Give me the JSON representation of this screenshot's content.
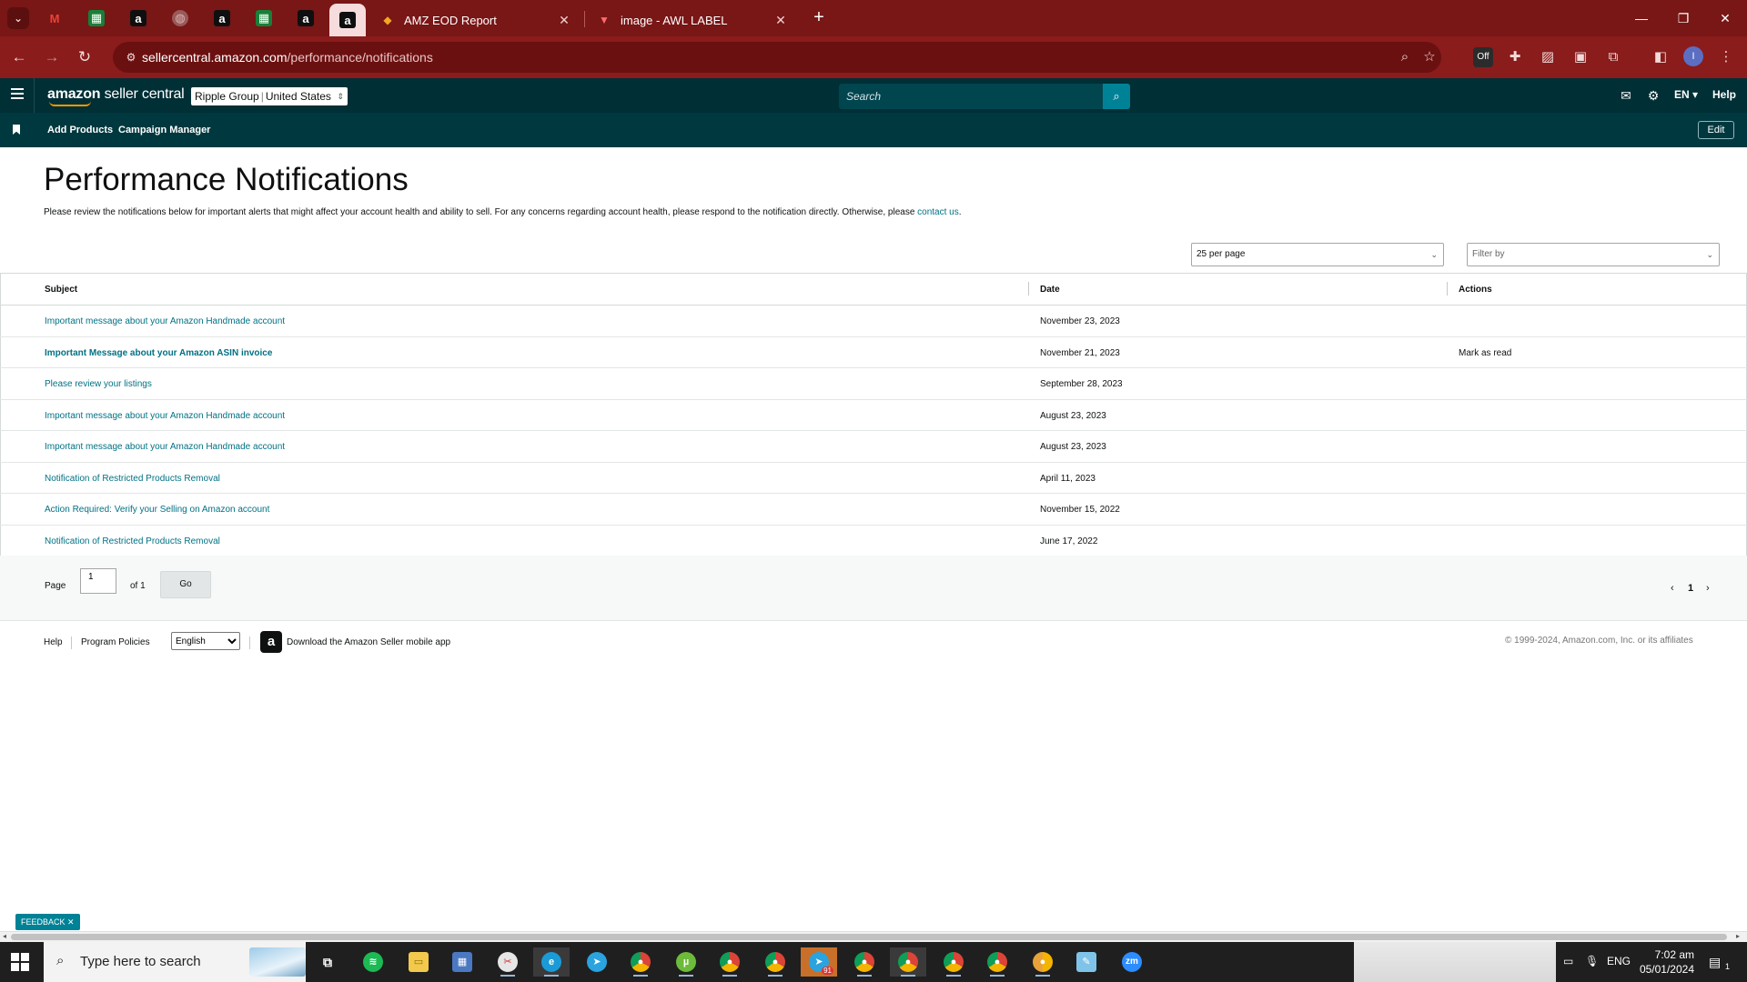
{
  "browser": {
    "tabs": [
      {
        "title": "AMZ EOD Report",
        "close": "✕"
      },
      {
        "title": "image - AWL LABEL",
        "close": "✕"
      }
    ],
    "pinned_tabs": [
      "gmail-icon",
      "sheets-icon",
      "amazon-icon",
      "globe-icon",
      "amazon-icon",
      "sheets-icon",
      "amazon-icon",
      "amazon-icon"
    ],
    "address": {
      "host": "sellercentral.amazon.com",
      "path": "/performance/notifications"
    },
    "profile_initial": "I",
    "extension_badge": "Off"
  },
  "header": {
    "logo_brand": "amazon",
    "logo_product": " seller central",
    "account_name": "Ripple Group",
    "account_marketplace": "United States",
    "search_placeholder": "Search",
    "language": "EN",
    "help": "Help"
  },
  "subnav": {
    "links": [
      "Add Products",
      "Campaign Manager"
    ],
    "edit_label": "Edit"
  },
  "page": {
    "title": "Performance Notifications",
    "intro": "Please review the notifications below for important alerts that might affect your account health and ability to sell. For any concerns regarding account health, please respond to the notification directly. Otherwise, please ",
    "contact_link": "contact us",
    "intro_end": "."
  },
  "controls": {
    "per_page": "25 per page",
    "filter_placeholder": "Filter by"
  },
  "table": {
    "headers": {
      "subject": "Subject",
      "date": "Date",
      "actions": "Actions"
    },
    "rows": [
      {
        "subject": "Important message about your Amazon Handmade account",
        "date": "November 23, 2023",
        "action": "",
        "unread": false
      },
      {
        "subject": "Important Message about your Amazon ASIN invoice",
        "date": "November 21, 2023",
        "action": "Mark as read",
        "unread": true
      },
      {
        "subject": "Please review your listings",
        "date": "September 28, 2023",
        "action": "",
        "unread": false
      },
      {
        "subject": "Important message about your Amazon Handmade account",
        "date": "August 23, 2023",
        "action": "",
        "unread": false
      },
      {
        "subject": "Important message about your Amazon Handmade account",
        "date": "August 23, 2023",
        "action": "",
        "unread": false
      },
      {
        "subject": "Notification of Restricted Products Removal",
        "date": "April 11, 2023",
        "action": "",
        "unread": false
      },
      {
        "subject": "Action Required: Verify your Selling on Amazon account",
        "date": "November 15, 2022",
        "action": "",
        "unread": false
      },
      {
        "subject": "Notification of Restricted Products Removal",
        "date": "June 17, 2022",
        "action": "",
        "unread": false
      }
    ]
  },
  "pager": {
    "page_label": "Page",
    "page_value": "1",
    "of_label": "of 1",
    "go_label": "Go",
    "current_page": "1"
  },
  "footer": {
    "help": "Help",
    "program_policies": "Program Policies",
    "language_option": "English",
    "app_link": "Download the Amazon Seller mobile app",
    "copyright": "© 1999-2024, Amazon.com, Inc. or its affiliates"
  },
  "feedback": {
    "label": "FEEDBACK",
    "close": "✕"
  },
  "taskbar": {
    "search_placeholder": "Type here to search",
    "language": "ENG",
    "time": "7:02 am",
    "date": "05/01/2024",
    "telegram_badge": "91",
    "notification_count": "1"
  },
  "colors": {
    "browser_frame": "#791616",
    "seller_header": "#002f36",
    "seller_subnav": "#00383f",
    "link": "#007185",
    "search_button": "#008296"
  }
}
